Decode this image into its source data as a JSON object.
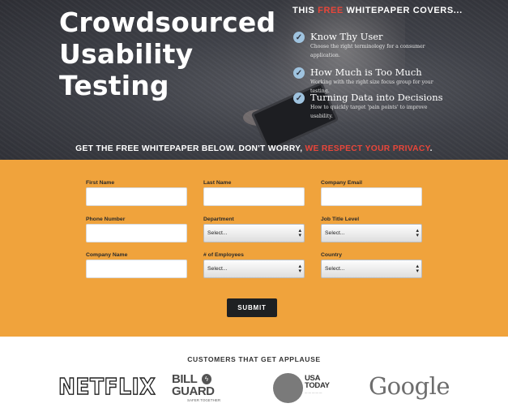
{
  "hero": {
    "title_line1": "Crowdsourced",
    "title_line2": "Usability",
    "title_line3": "Testing",
    "covers_prefix": "THIS ",
    "covers_highlight": "FREE",
    "covers_suffix": " WHITEPAPER COVERS...",
    "items": [
      {
        "title": "Know Thy User",
        "desc": "Choose the right terminology for a consumer application."
      },
      {
        "title": "How Much is Too Much",
        "desc": "Working with the right size focus group for your testing."
      },
      {
        "title": "Turning Data into Decisions",
        "desc": "How to quickly target 'pain points' to improve usability."
      }
    ],
    "banner_prefix": "GET THE FREE WHITEPAPER BELOW. DON'T WORRY, ",
    "banner_highlight": "WE RESPECT YOUR PRIVACY",
    "banner_suffix": "."
  },
  "form": {
    "first_name_label": "First Name",
    "last_name_label": "Last Name",
    "company_email_label": "Company Email",
    "phone_label": "Phone Number",
    "department_label": "Department",
    "department_value": "Select...",
    "job_title_label": "Job Title Level",
    "job_title_value": "Select...",
    "company_name_label": "Company Name",
    "employees_label": "# of Employees",
    "employees_value": "Select...",
    "country_label": "Country",
    "country_value": "Select...",
    "submit_label": "SUBMIT"
  },
  "customers": {
    "heading": "CUSTOMERS THAT GET APPLAUSE",
    "netflix": "NETFLIX",
    "billguard_line1": "BILL",
    "billguard_line2": "GUARD",
    "billguard_tagline": "SAFER TOGETHER",
    "usatoday_line1": "USA",
    "usatoday_line2": "TODAY",
    "google": "Google"
  },
  "colors": {
    "hero_bg": "#3f4148",
    "accent_red": "#e8463a",
    "form_bg": "#f0a33c",
    "submit_bg": "#1e2022",
    "check_icon": "#9fc3df"
  },
  "icons": {
    "check": "check-circle-icon",
    "select_arrow": "updown-arrow-icon"
  }
}
